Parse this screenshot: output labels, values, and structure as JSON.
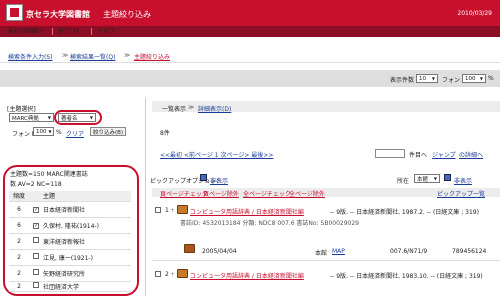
{
  "header": {
    "title": "京セラ大学図書館",
    "subtitle": "主題絞り込み",
    "date": "2010/03/29"
  },
  "nav": {
    "menu": "最初の画面へ",
    "exit": "終了(X)",
    "help": "ヘルプ"
  },
  "breadcrumb": {
    "b1": "検索条件入力(S)",
    "b2": "検索結果一覧(Q)",
    "b3": "主題絞り込み"
  },
  "toolbar": {
    "count_label": "表示件数",
    "count_value": "10",
    "font_label": "フォント",
    "font_value": "100",
    "pct": "%"
  },
  "left": {
    "section_title": "[主題選択]",
    "marc_value": "MARC典拠",
    "sort_value": "著者名",
    "font_label": "フォント",
    "font_value": "100",
    "clear": "クリア",
    "refine_button": "絞り込み(B)",
    "summary1": "主題数=150 MARC関連書誌",
    "summary2": "数 AV=2 NC=118",
    "col_freq": "頻度",
    "col_subject": "主題",
    "rows": [
      {
        "freq": "6",
        "checked": true,
        "label": "日本経済新聞社"
      },
      {
        "freq": "6",
        "checked": true,
        "label": "久保村, 隆祐(1914-)"
      },
      {
        "freq": "2",
        "checked": false,
        "label": "東洋経済新報社"
      },
      {
        "freq": "2",
        "checked": false,
        "label": "江見, 康一(1921-)"
      },
      {
        "freq": "2",
        "checked": false,
        "label": "矢野経済研究所"
      },
      {
        "freq": "2",
        "checked": false,
        "label": "社団経済大学"
      }
    ]
  },
  "right": {
    "view_list": "一覧表示",
    "view_detail": "詳細表示(D)",
    "count": "8件",
    "paging": "<<最初 <前ページ 1 次ページ> 最後>>",
    "page_label": "件目へ",
    "jump": "ジャンプ",
    "more": "の詳細へ",
    "pickup_label": "ピックアップオプション：",
    "hidden": "非表示",
    "location_label": "所在",
    "location_value": "本館",
    "pickup_view": "ピックアップ一覧",
    "t_page_add": "頁ページチェック",
    "t_page_remove": "頁ページ除外",
    "t_all_add": "全ページチェック",
    "t_all_remove": "全ページ除外",
    "r1_no": "1",
    "r1_title": "コンピュータ用語辞典 / 日本経済新聞社編",
    "r1_rest": "-- 9版. -- 日本経済新聞社, 1987.2. -- (日経文庫 ; 319)",
    "r1_meta": "書誌ID: 4532013184  分類: NDC8 007.6  書誌No: SB00029029",
    "r1_date": "2005/04/04",
    "r1_place_label": "本館",
    "r1_place": "MAP",
    "r1_call": "007.6/N71/9",
    "r1_id": "789456124",
    "r2_no": "2",
    "r2_title": "コンピュータ用語辞典 / 日本経済新聞社編",
    "r2_rest": "-- 9版. -- 日本経済新聞社, 1983.10. -- (日経文庫 ; 319)"
  }
}
